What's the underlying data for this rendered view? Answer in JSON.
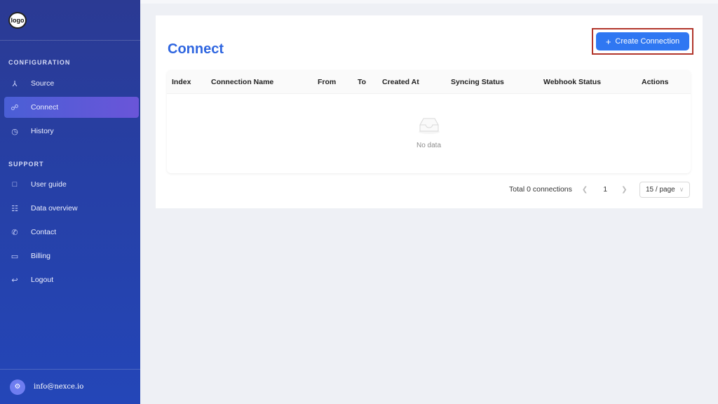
{
  "sidebar": {
    "logo_text": "logo",
    "sections": {
      "configuration": "CONFIGURATION",
      "support": "SUPPORT"
    },
    "items": [
      {
        "label": "Source",
        "icon": "source-icon"
      },
      {
        "label": "Connect",
        "icon": "connect-icon",
        "active": true
      },
      {
        "label": "History",
        "icon": "history-icon"
      },
      {
        "label": "User guide",
        "icon": "user-guide-icon"
      },
      {
        "label": "Data overview",
        "icon": "data-overview-icon"
      },
      {
        "label": "Contact",
        "icon": "contact-icon"
      },
      {
        "label": "Billing",
        "icon": "billing-icon"
      },
      {
        "label": "Logout",
        "icon": "logout-icon"
      }
    ],
    "footer_email": "info@nexce.io"
  },
  "main": {
    "title": "Connect",
    "create_button": "Create Connection",
    "table": {
      "columns": [
        "Index",
        "Connection Name",
        "From",
        "To",
        "Created At",
        "Syncing Status",
        "Webhook Status",
        "Actions"
      ],
      "empty_text": "No data"
    },
    "pagination": {
      "total": "Total 0 connections",
      "current_page": "1",
      "page_size": "15 / page"
    }
  },
  "colors": {
    "accent": "#2f77f2",
    "title": "#2f66e0",
    "sidebar": "#2640a6",
    "highlight_border": "#b1352b"
  }
}
